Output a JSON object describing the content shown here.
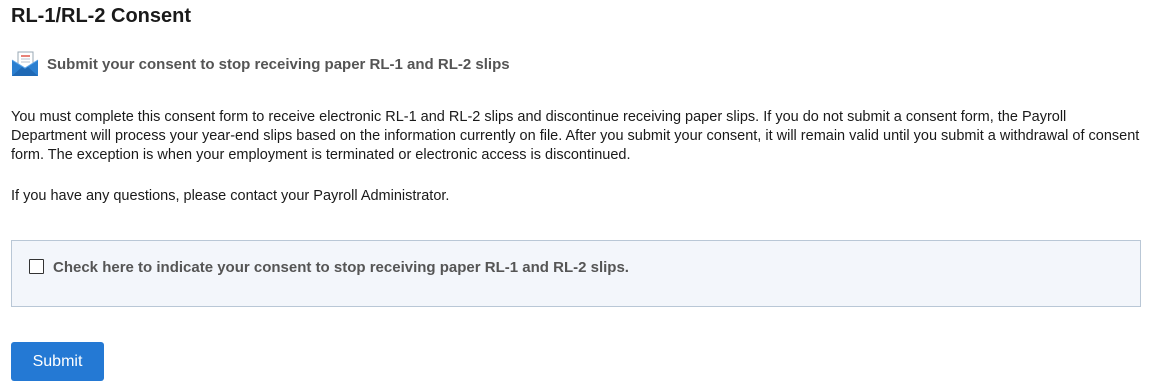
{
  "page": {
    "title": "RL-1/RL-2 Consent"
  },
  "subheader": {
    "icon": "envelope-document-icon",
    "text": "Submit your consent to stop receiving paper RL-1 and RL-2 slips"
  },
  "body": {
    "paragraph1": "You must complete this consent form to receive electronic RL-1 and RL-2 slips and discontinue receiving paper slips.  If you do not submit a consent form, the Payroll Department will process your year-end slips based on the information currently on file.  After you submit your consent, it will remain valid until you submit a withdrawal of consent form.  The exception is when your employment is terminated or electronic access is discontinued.",
    "paragraph2": "If you have any questions, please contact your Payroll Administrator."
  },
  "consent": {
    "checked": false,
    "label": "Check here to indicate your consent to stop receiving paper RL-1 and RL-2 slips."
  },
  "actions": {
    "submit_label": "Submit"
  },
  "colors": {
    "accent": "#2479d4",
    "consent_box_bg": "#f3f6fb",
    "consent_box_border": "#b9c7d6",
    "muted_text": "#555555"
  }
}
